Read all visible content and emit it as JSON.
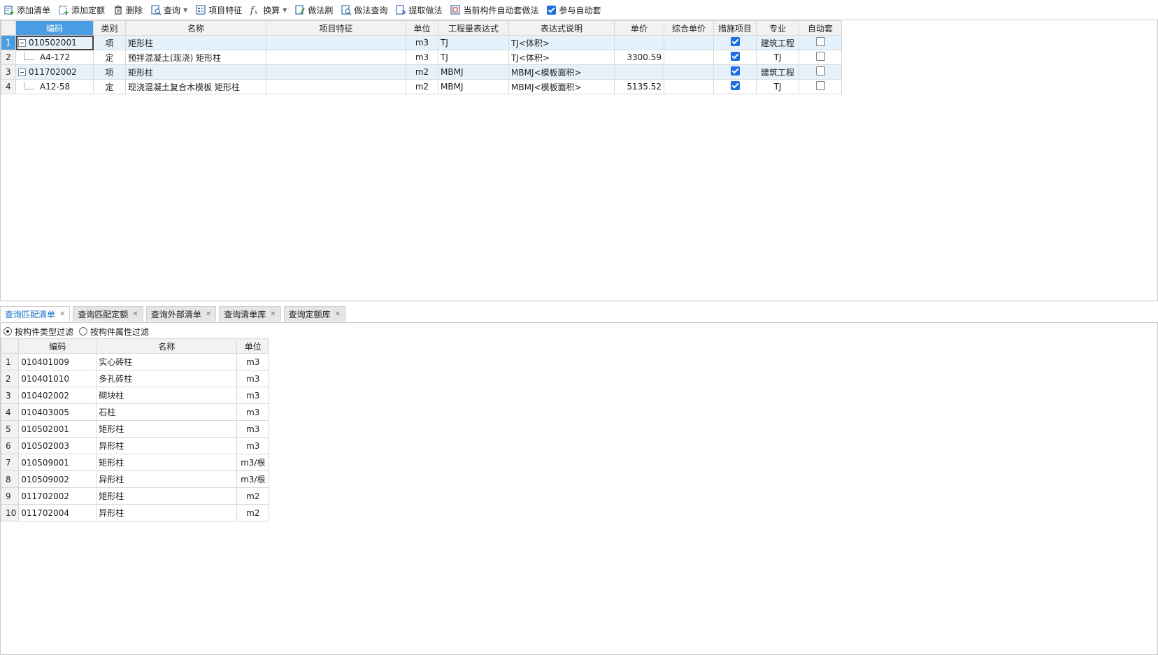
{
  "toolbar": {
    "buttons": [
      {
        "label": "添加清单",
        "icon": "add-list-icon"
      },
      {
        "label": "添加定额",
        "icon": "add-quota-icon"
      },
      {
        "label": "删除",
        "icon": "trash-icon"
      },
      {
        "label": "查询",
        "icon": "query-icon",
        "dropdown": true
      },
      {
        "label": "项目特征",
        "icon": "feature-icon"
      },
      {
        "label": "换算",
        "icon": "fx-icon",
        "dropdown": true
      },
      {
        "label": "做法刷",
        "icon": "brush-icon"
      },
      {
        "label": "做法查询",
        "icon": "method-query-icon"
      },
      {
        "label": "提取做法",
        "icon": "extract-icon"
      },
      {
        "label": "当前构件自动套做法",
        "icon": "auto-apply-icon"
      }
    ],
    "auto_checkbox_label": "参与自动套",
    "auto_checkbox_checked": true
  },
  "main_grid": {
    "columns": [
      "编码",
      "类别",
      "名称",
      "项目特征",
      "单位",
      "工程量表达式",
      "表达式说明",
      "单价",
      "综合单价",
      "措施项目",
      "专业",
      "自动套"
    ],
    "rows": [
      {
        "num": "1",
        "code": "010502001",
        "type": "项",
        "name": "矩形柱",
        "feature": "",
        "unit": "m3",
        "expr": "TJ",
        "desc": "TJ<体积>",
        "price": "",
        "total_price": "",
        "measure": true,
        "major": "建筑工程",
        "auto": false,
        "level": 0
      },
      {
        "num": "2",
        "code": "A4-172",
        "type": "定",
        "name": "预拌混凝土(现浇) 矩形柱",
        "feature": "",
        "unit": "m3",
        "expr": "TJ",
        "desc": "TJ<体积>",
        "price": "3300.59",
        "total_price": "",
        "measure": true,
        "major": "TJ",
        "auto": false,
        "level": 1
      },
      {
        "num": "3",
        "code": "011702002",
        "type": "项",
        "name": "矩形柱",
        "feature": "",
        "unit": "m2",
        "expr": "MBMJ",
        "desc": "MBMJ<模板面积>",
        "price": "",
        "total_price": "",
        "measure": true,
        "major": "建筑工程",
        "auto": false,
        "level": 0
      },
      {
        "num": "4",
        "code": "A12-58",
        "type": "定",
        "name": "现浇混凝土复合木模板 矩形柱",
        "feature": "",
        "unit": "m2",
        "expr": "MBMJ",
        "desc": "MBMJ<模板面积>",
        "price": "5135.52",
        "total_price": "",
        "measure": true,
        "major": "TJ",
        "auto": false,
        "level": 1
      }
    ]
  },
  "tabs": [
    {
      "label": "查询匹配清单",
      "active": true
    },
    {
      "label": "查询匹配定额",
      "active": false
    },
    {
      "label": "查询外部清单",
      "active": false
    },
    {
      "label": "查询清单库",
      "active": false
    },
    {
      "label": "查询定额库",
      "active": false
    }
  ],
  "filter": {
    "option1": "按构件类型过滤",
    "option2": "按构件属性过滤",
    "selected": 1
  },
  "query_grid": {
    "columns": [
      "编码",
      "名称",
      "单位"
    ],
    "rows": [
      {
        "num": "1",
        "code": "010401009",
        "name": "实心砖柱",
        "unit": "m3"
      },
      {
        "num": "2",
        "code": "010401010",
        "name": "多孔砖柱",
        "unit": "m3"
      },
      {
        "num": "3",
        "code": "010402002",
        "name": "砌块柱",
        "unit": "m3"
      },
      {
        "num": "4",
        "code": "010403005",
        "name": "石柱",
        "unit": "m3"
      },
      {
        "num": "5",
        "code": "010502001",
        "name": "矩形柱",
        "unit": "m3"
      },
      {
        "num": "6",
        "code": "010502003",
        "name": "异形柱",
        "unit": "m3"
      },
      {
        "num": "7",
        "code": "010509001",
        "name": "矩形柱",
        "unit": "m3/根"
      },
      {
        "num": "8",
        "code": "010509002",
        "name": "异形柱",
        "unit": "m3/根"
      },
      {
        "num": "9",
        "code": "011702002",
        "name": "矩形柱",
        "unit": "m2"
      },
      {
        "num": "10",
        "code": "011702004",
        "name": "异形柱",
        "unit": "m2"
      }
    ]
  },
  "colors": {
    "accent": "#1d6fe0",
    "selected_header": "#4a9de2",
    "row_highlight": "#e6f2fb"
  }
}
